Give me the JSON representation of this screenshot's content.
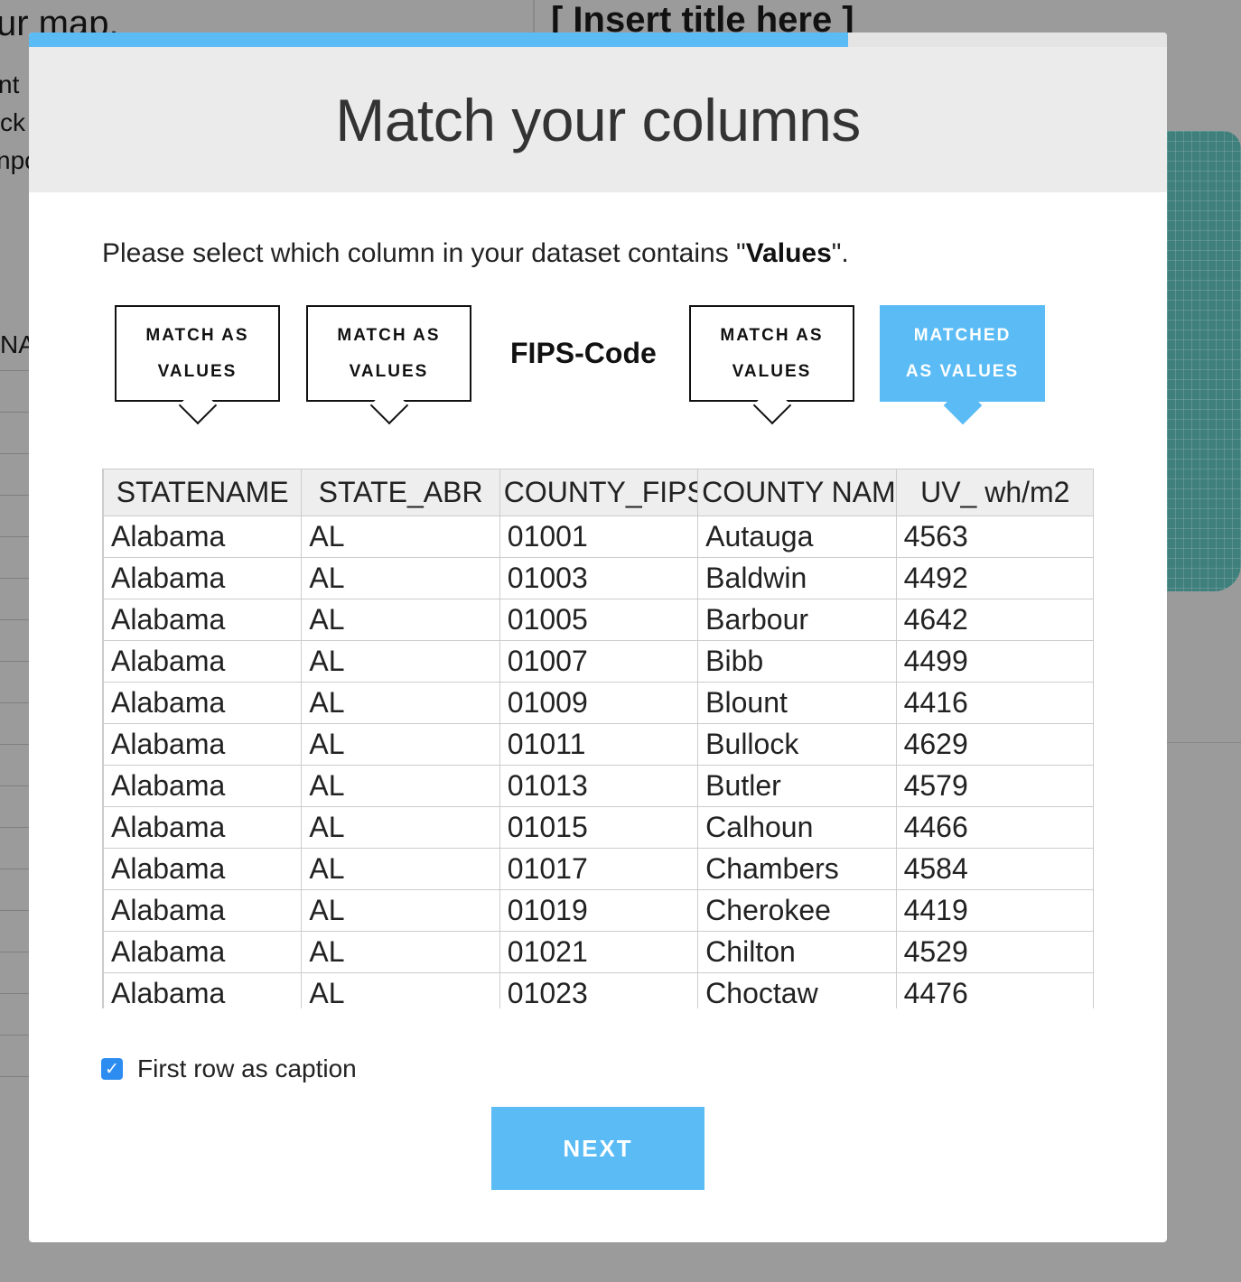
{
  "background": {
    "left_title": "ur map.",
    "right_title": "[ Insert title here ]",
    "side_texts": [
      "nt",
      "ck",
      "npo"
    ],
    "side_label": "NA"
  },
  "modal": {
    "progress_percent": 72,
    "title": "Match your columns",
    "prompt_before": "Please select which column in your dataset contains \"",
    "prompt_bold": "Values",
    "prompt_after": "\".",
    "matchers": [
      {
        "line1": "MATCH AS",
        "line2": "VALUES",
        "state": "unmatched"
      },
      {
        "line1": "MATCH AS",
        "line2": "VALUES",
        "state": "unmatched"
      },
      {
        "label": "FIPS-Code",
        "state": "assigned"
      },
      {
        "line1": "MATCH AS",
        "line2": "VALUES",
        "state": "unmatched"
      },
      {
        "line1": "MATCHED",
        "line2": "AS VALUES",
        "state": "matched"
      }
    ],
    "table": {
      "headers": [
        "STATENAME",
        "STATE_ABR",
        "COUNTY_FIPS",
        "COUNTY NAME",
        "UV_ wh/m2"
      ],
      "rows": [
        [
          "Alabama",
          "AL",
          "01001",
          "Autauga",
          "4563"
        ],
        [
          "Alabama",
          "AL",
          "01003",
          "Baldwin",
          "4492"
        ],
        [
          "Alabama",
          "AL",
          "01005",
          "Barbour",
          "4642"
        ],
        [
          "Alabama",
          "AL",
          "01007",
          "Bibb",
          "4499"
        ],
        [
          "Alabama",
          "AL",
          "01009",
          "Blount",
          "4416"
        ],
        [
          "Alabama",
          "AL",
          "01011",
          "Bullock",
          "4629"
        ],
        [
          "Alabama",
          "AL",
          "01013",
          "Butler",
          "4579"
        ],
        [
          "Alabama",
          "AL",
          "01015",
          "Calhoun",
          "4466"
        ],
        [
          "Alabama",
          "AL",
          "01017",
          "Chambers",
          "4584"
        ],
        [
          "Alabama",
          "AL",
          "01019",
          "Cherokee",
          "4419"
        ],
        [
          "Alabama",
          "AL",
          "01021",
          "Chilton",
          "4529"
        ],
        [
          "Alabama",
          "AL",
          "01023",
          "Choctaw",
          "4476"
        ]
      ]
    },
    "first_row_caption": {
      "label": "First row as caption",
      "checked": true
    },
    "next_label": "NEXT",
    "colors": {
      "accent": "#5bbcf5",
      "checkbox": "#2d8cf0",
      "header_bg": "#ebebeb"
    }
  }
}
